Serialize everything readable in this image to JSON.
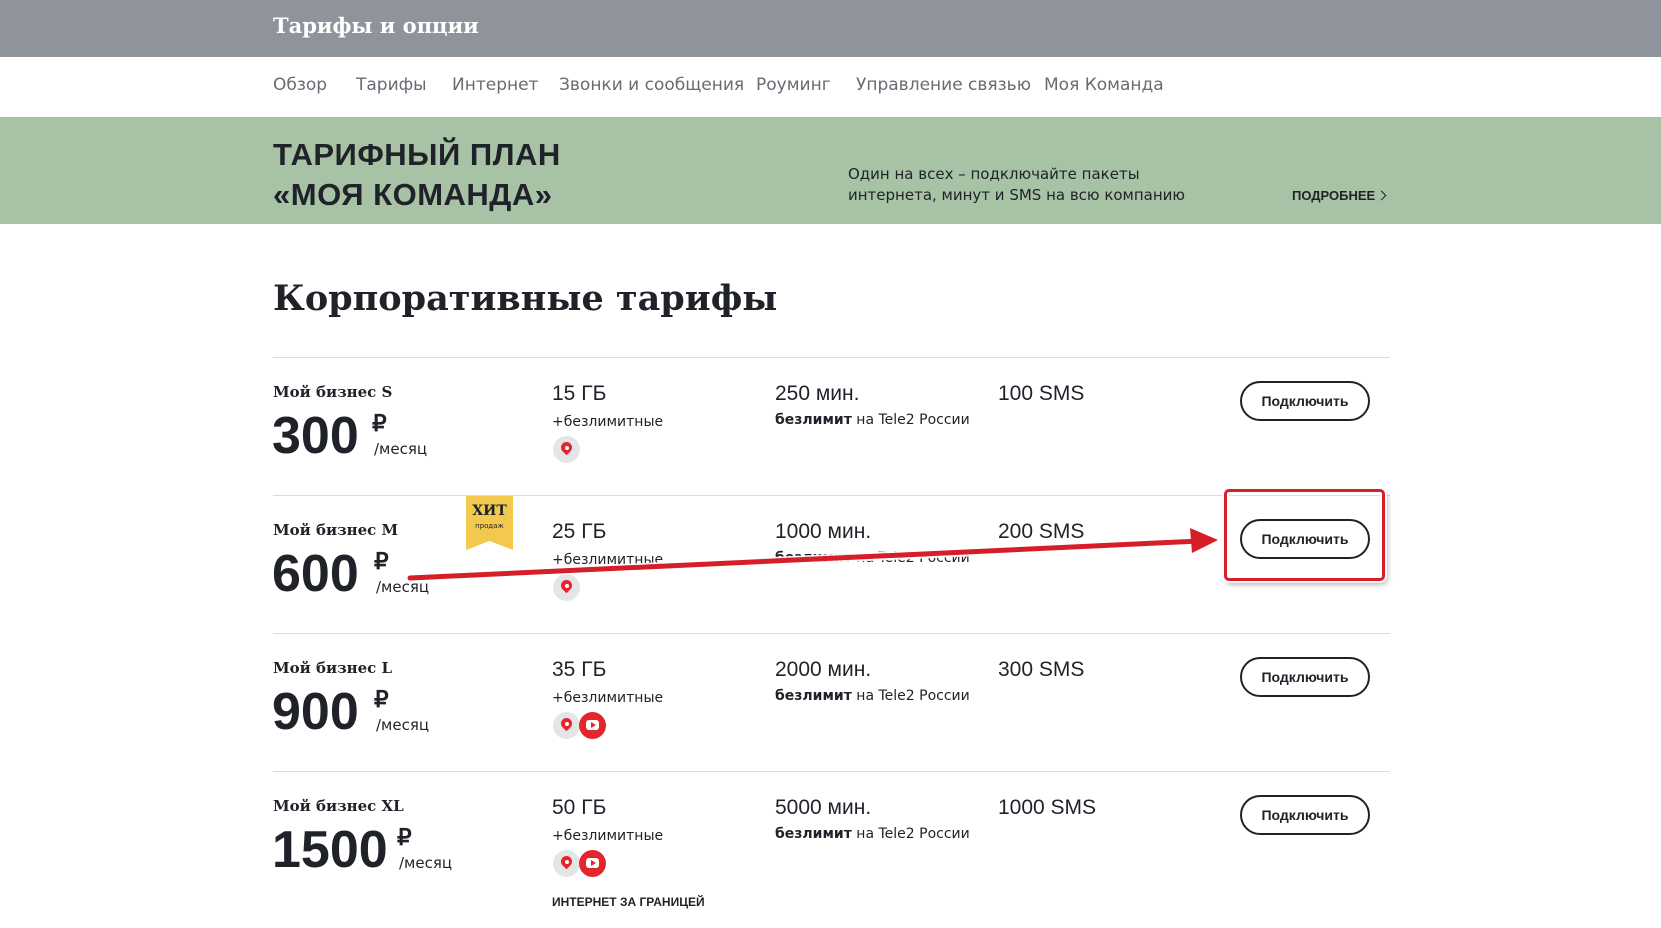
{
  "header": {
    "title": "Тарифы и опции"
  },
  "nav": {
    "items": [
      "Обзор",
      "Тарифы",
      "Интернет",
      "Звонки и сообщения",
      "Роуминг",
      "Управление связью",
      "Моя Команда"
    ]
  },
  "banner": {
    "title_line1": "ТАРИФНЫЙ ПЛАН",
    "title_line2": "«МОЯ КОМАНДА»",
    "text_line1": "Один на всех – подключайте пакеты",
    "text_line2": "интернета, минут и SMS на всю компанию",
    "more_label": "ПОДРОБНЕЕ"
  },
  "section": {
    "title": "Корпоративные тарифы"
  },
  "tariffs": [
    {
      "name": "Мой бизнес S",
      "price": "300",
      "currency": "₽",
      "period": "/месяц",
      "gb": "15 ГБ",
      "unlim": "+безлимитные",
      "minutes": "250 мин.",
      "bezlimit_bold": "безлимит",
      "bezlimit_rest": " на Tele2 России",
      "sms": "100 SMS",
      "button": "Подключить",
      "apps": [
        "geo-icon"
      ]
    },
    {
      "name": "Мой бизнес M",
      "price": "600",
      "currency": "₽",
      "period": "/месяц",
      "gb": "25 ГБ",
      "unlim": "+безлимитные",
      "minutes": "1000 мин.",
      "bezlimit_bold": "безлимит",
      "bezlimit_rest": " на Tele2 России",
      "sms": "200 SMS",
      "button": "Подключить",
      "apps": [
        "geo-icon"
      ],
      "badge": "ХИТ",
      "badge_sub": "продаж"
    },
    {
      "name": "Мой бизнес L",
      "price": "900",
      "currency": "₽",
      "period": "/месяц",
      "gb": "35 ГБ",
      "unlim": "+безлимитные",
      "minutes": "2000 мин.",
      "bezlimit_bold": "безлимит",
      "bezlimit_rest": " на Tele2 России",
      "sms": "300 SMS",
      "button": "Подключить",
      "apps": [
        "geo-icon",
        "youtube-icon"
      ]
    },
    {
      "name": "Мой бизнес XL",
      "price": "1500",
      "currency": "₽",
      "period": "/месяц",
      "gb": "50 ГБ",
      "unlim": "+безлимитные",
      "minutes": "5000 мин.",
      "bezlimit_bold": "безлимит",
      "bezlimit_rest": " на Tele2 России",
      "sms": "1000 SMS",
      "button": "Подключить",
      "apps": [
        "geo-icon",
        "youtube-icon"
      ],
      "extra": "ИНТЕРНЕТ ЗА ГРАНИЦЕЙ"
    }
  ],
  "colors": {
    "topbar": "#8f949c",
    "banner": "#a7c2a4",
    "badge": "#f2c94c",
    "annotation": "#d51e28",
    "brand_red": "#e3262e"
  }
}
